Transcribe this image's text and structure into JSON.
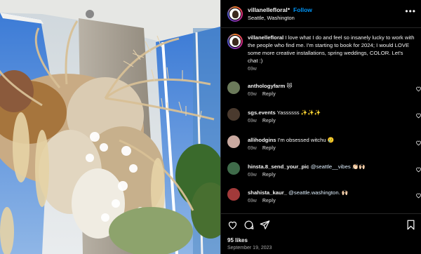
{
  "post": {
    "username": "villanellefloral",
    "dot": "•",
    "follow_label": "Follow",
    "location": "Seattle, Washington",
    "more_icon": "more-horizontal-icon"
  },
  "caption": {
    "username": "villanellefloral",
    "text": "I love what I do and feel so insanely lucky to work with the people who find me. I'm starting to book for 2024; I would LOVE some more creative installations, spring weddings, COLOR. Let's chat :)",
    "time": "69w"
  },
  "comments": [
    {
      "username": "anthologyfarm",
      "text": "😻",
      "mention": "",
      "time": "69w",
      "reply": "Reply",
      "avatar_color": "#6b7a5a"
    },
    {
      "username": "sgs.events",
      "text": "Yassssss ✨✨✨",
      "mention": "",
      "time": "69w",
      "reply": "Reply",
      "avatar_color": "#4a3a2e"
    },
    {
      "username": "allihodgins",
      "text": "I'm obsessed witchu 🥲",
      "mention": "",
      "time": "69w",
      "reply": "Reply",
      "avatar_color": "#c9a9a0"
    },
    {
      "username": "hinsta.8_send_your_pic",
      "text": " 👏🏻🙌🏻",
      "mention": "@seattle__vibes",
      "time": "69w",
      "reply": "Reply",
      "avatar_color": "#3f6b4a"
    },
    {
      "username": "shahista_kaur_",
      "text": " 🙌🏻",
      "mention": "@seattle.washington.",
      "time": "69w",
      "reply": "Reply",
      "avatar_color": "#a23a3a"
    }
  ],
  "actions": {
    "like_icon": "heart-icon",
    "comment_icon": "comment-icon",
    "share_icon": "share-icon",
    "save_icon": "bookmark-icon",
    "likes": "95 likes",
    "date": "September 19, 2023"
  },
  "colors": {
    "background": "#000000",
    "link": "#0095f6",
    "secondary_text": "#a8a8a8"
  }
}
